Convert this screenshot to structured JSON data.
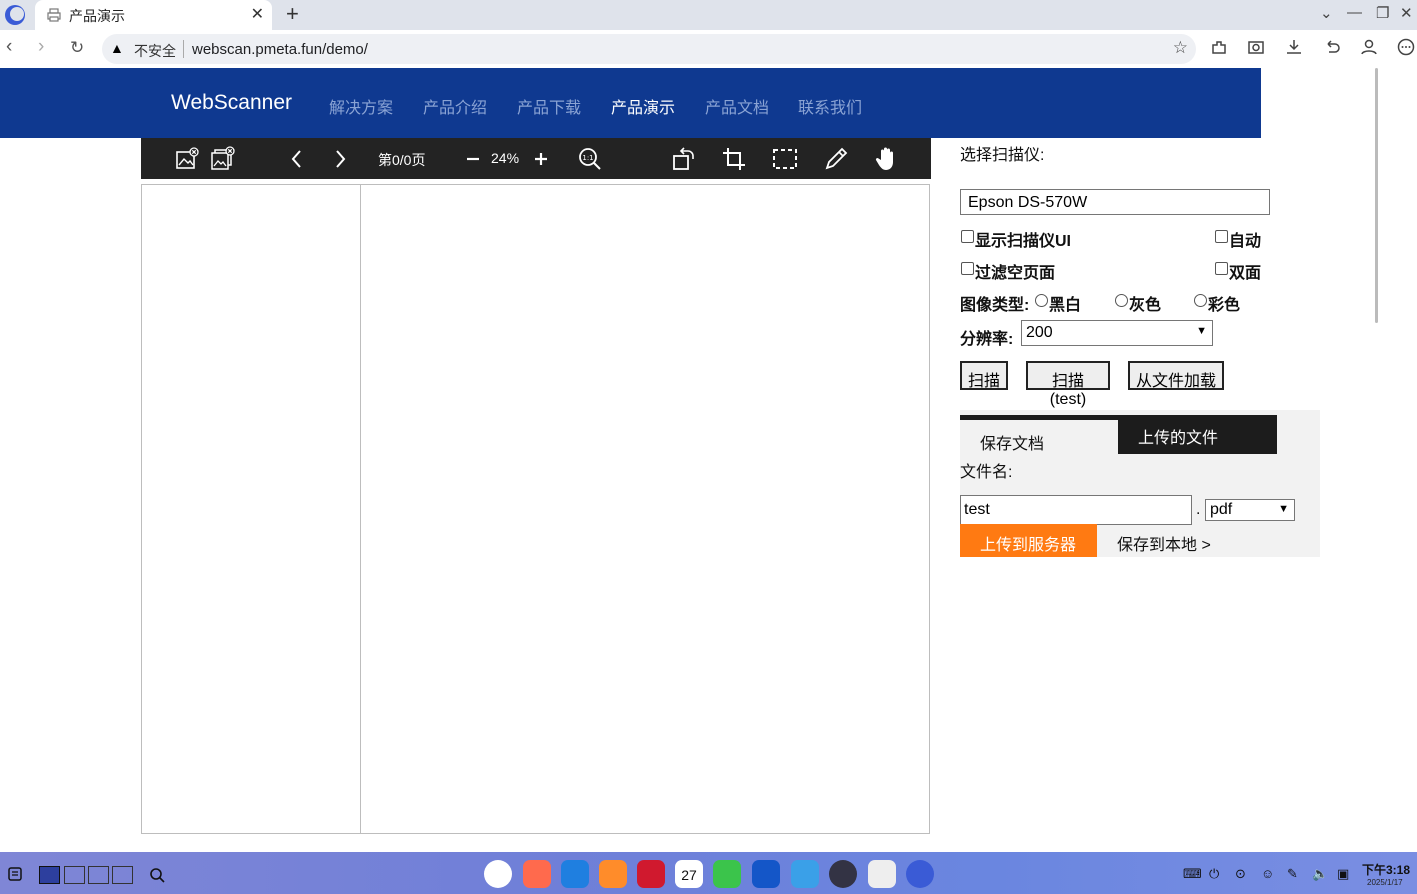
{
  "browser": {
    "tab_title": "产品演示",
    "url": "webscan.pmeta.fun/demo/",
    "security_label": "不安全"
  },
  "site": {
    "brand": "WebScanner",
    "nav": [
      "解决方案",
      "产品介绍",
      "产品下载",
      "产品演示",
      "产品文档",
      "联系我们"
    ],
    "active_nav": "产品演示"
  },
  "viewer": {
    "page_info": "第0/0页",
    "zoom": "24%"
  },
  "scan_panel": {
    "select_scanner_label": "选择扫描仪:",
    "scanner_value": "Epson DS-570W",
    "show_ui_label": "显示扫描仪UI",
    "auto_label": "自动",
    "filter_blank_label": "过滤空页面",
    "duplex_label": "双面",
    "image_type_label": "图像类型:",
    "image_types": [
      "黑白",
      "灰色",
      "彩色"
    ],
    "resolution_label": "分辨率:",
    "resolution_value": "200",
    "scan_button": "扫描",
    "scan_test_button": "扫描(test)",
    "load_file_button": "从文件加载"
  },
  "save_panel": {
    "tab_save_doc": "保存文档",
    "tab_uploaded": "上传的文件",
    "filename_label": "文件名:",
    "filename_value": "test",
    "dot": ".",
    "format_value": "pdf",
    "upload_button": "上传到服务器",
    "save_local_link": "保存到本地 >"
  },
  "taskbar": {
    "time": "下午3:18",
    "date": "2025/1/17",
    "calendar_day": "27"
  }
}
